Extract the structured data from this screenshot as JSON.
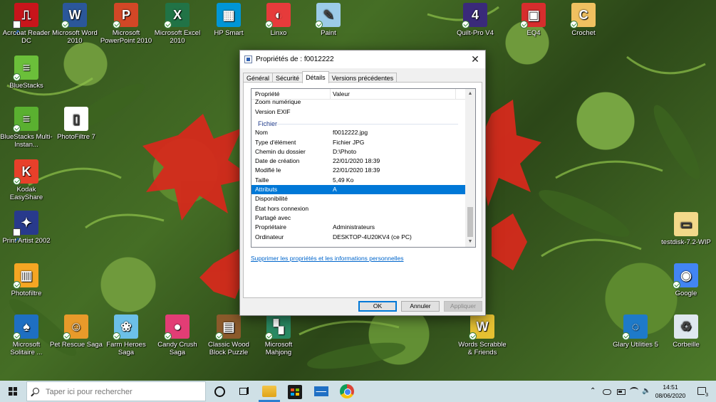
{
  "desktop_icons": [
    {
      "label": "Acrobat Reader DC",
      "color": "#c8151b",
      "glyph": "⎍",
      "badge": "shortcut"
    },
    {
      "label": "Microsoft Word 2010",
      "color": "#2b579a",
      "glyph": "W",
      "badge": "check"
    },
    {
      "label": "Microsoft PowerPoint 2010",
      "color": "#d24726",
      "glyph": "P",
      "badge": "check"
    },
    {
      "label": "Microsoft Excel 2010",
      "color": "#217346",
      "glyph": "X",
      "badge": "check"
    },
    {
      "label": "HP Smart",
      "color": "#0096d6",
      "glyph": "▦",
      "badge": "none"
    },
    {
      "label": "Linxo",
      "color": "#e63b3b",
      "glyph": "◐",
      "badge": "check"
    },
    {
      "label": "Paint",
      "color": "#9ccbe8",
      "glyph": "✎",
      "badge": "check"
    },
    {
      "label": "Quilt-Pro V4",
      "color": "#3a2a7a",
      "glyph": "4",
      "badge": "check"
    },
    {
      "label": "EQ4",
      "color": "#d62d2d",
      "glyph": "▣",
      "badge": "check"
    },
    {
      "label": "Crochet",
      "color": "#f0c060",
      "glyph": "C",
      "badge": "check"
    },
    {
      "label": "BlueStacks",
      "color": "#6bbf3a",
      "glyph": "≡",
      "badge": "check"
    },
    {
      "label": "BlueStacks Multi-Instan...",
      "color": "#5ab030",
      "glyph": "≡",
      "badge": "check"
    },
    {
      "label": "PhotoFiltre 7",
      "color": "#ffffff",
      "glyph": "▯",
      "badge": "none"
    },
    {
      "label": "Kodak EasyShare",
      "color": "#e8402a",
      "glyph": "K",
      "badge": "check"
    },
    {
      "label": "Print Artist 2002",
      "color": "#283a8c",
      "glyph": "✦",
      "badge": "shortcut"
    },
    {
      "label": "Photofiltre",
      "color": "#f5a623",
      "glyph": "▥",
      "badge": "check"
    },
    {
      "label": "Microsoft Solitaire ...",
      "color": "#1e6fc2",
      "glyph": "♠",
      "badge": "check"
    },
    {
      "label": "Pet Rescue Saga",
      "color": "#e89a2a",
      "glyph": "☺",
      "badge": "check"
    },
    {
      "label": "Farm Heroes Saga",
      "color": "#6cc0e8",
      "glyph": "❀",
      "badge": "check"
    },
    {
      "label": "Candy Crush Saga",
      "color": "#e23d75",
      "glyph": "●",
      "badge": "check"
    },
    {
      "label": "Classic Wood Block Puzzle",
      "color": "#8b5a2b",
      "glyph": "▤",
      "badge": "check"
    },
    {
      "label": "Microsoft Mahjong",
      "color": "#2a8a64",
      "glyph": "▚",
      "badge": "check"
    },
    {
      "label": "Words Scrabble & Friends",
      "color": "#e6c132",
      "glyph": "W",
      "badge": "check"
    },
    {
      "label": "testdisk-7.2-WIP",
      "color": "#f3d98a",
      "glyph": "▭",
      "badge": "none"
    },
    {
      "label": "Google",
      "color": "#4285f4",
      "glyph": "◉",
      "badge": "check"
    },
    {
      "label": "Glary Utilities 5",
      "color": "#1e7ac9",
      "glyph": "◌",
      "badge": "check"
    },
    {
      "label": "Corbeille",
      "color": "#dfe8ef",
      "glyph": "♻",
      "badge": "none"
    }
  ],
  "dialog": {
    "title": "Propriétés de : f0012222",
    "close_label": "✕",
    "tabs": [
      "Général",
      "Sécurité",
      "Détails",
      "Versions précédentes"
    ],
    "active_tab": "Détails",
    "columns": {
      "property": "Propriété",
      "value": "Valeur"
    },
    "partial_row": "Zoom numérique",
    "rows_before": [
      {
        "k": "Version EXIF",
        "v": ""
      }
    ],
    "group_label": "Fichier",
    "rows": [
      {
        "k": "Nom",
        "v": "f0012222.jpg"
      },
      {
        "k": "Type d'élément",
        "v": "Fichier JPG"
      },
      {
        "k": "Chemin du dossier",
        "v": "D:\\Photo"
      },
      {
        "k": "Date de création",
        "v": "22/01/2020 18:39"
      },
      {
        "k": "Modifié le",
        "v": "22/01/2020 18:39"
      },
      {
        "k": "Taille",
        "v": "5,49 Ko"
      },
      {
        "k": "Attributs",
        "v": "A"
      },
      {
        "k": "Disponibilité",
        "v": ""
      },
      {
        "k": "État hors connexion",
        "v": ""
      },
      {
        "k": "Partagé avec",
        "v": ""
      },
      {
        "k": "Propriétaire",
        "v": "Administrateurs"
      },
      {
        "k": "Ordinateur",
        "v": "DESKTOP-4U20KV4 (ce PC)"
      }
    ],
    "selected_row": "Attributs",
    "remove_link": "Supprimer les propriétés et les informations personnelles",
    "buttons": {
      "ok": "OK",
      "cancel": "Annuler",
      "apply": "Appliquer"
    },
    "scroll_up": "▲",
    "scroll_down": "▼"
  },
  "taskbar": {
    "search_placeholder": "Taper ici pour rechercher",
    "time": "14:51",
    "date": "08/06/2020",
    "chevron": "⌃",
    "sound": "🔈",
    "notification_count": "3",
    "accent": "#2b7fd0"
  }
}
